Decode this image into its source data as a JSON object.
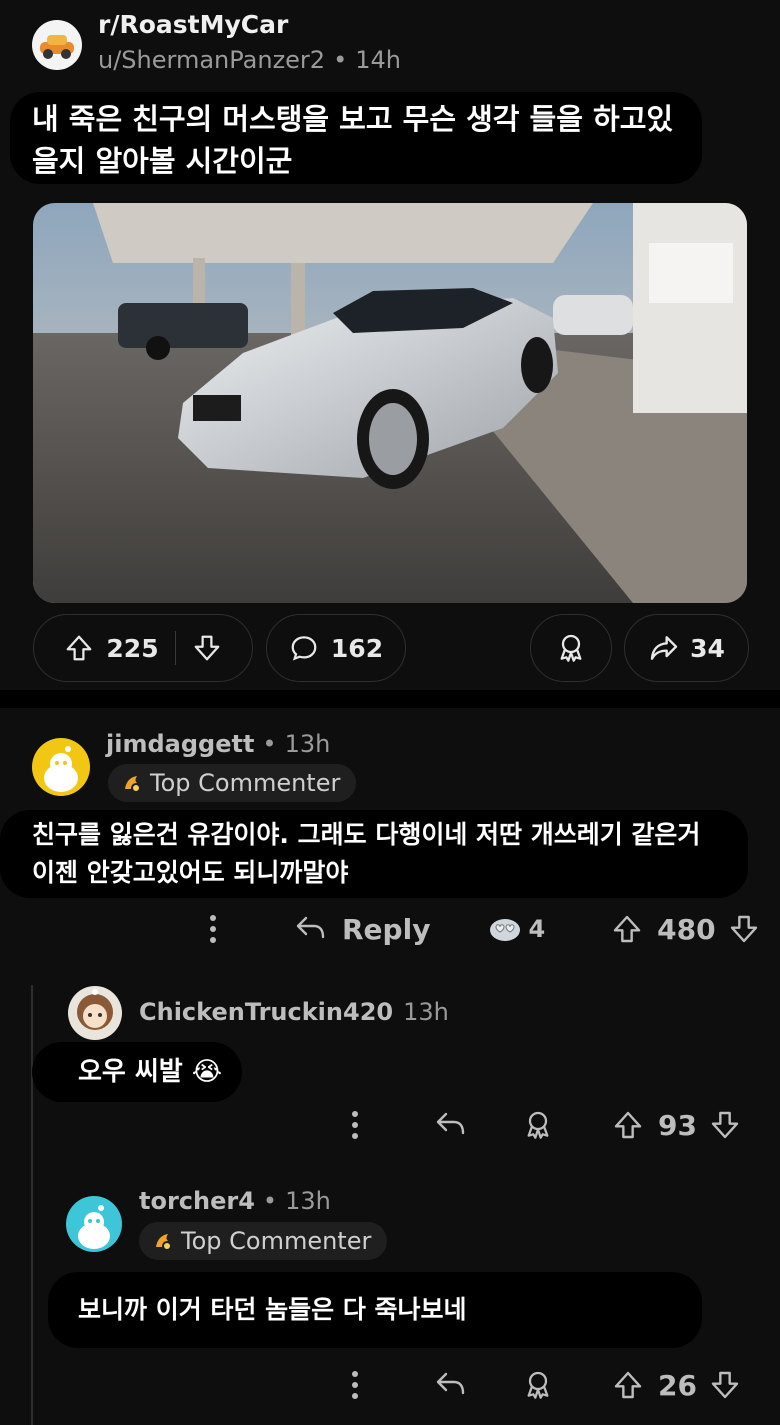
{
  "post": {
    "subreddit": "r/RoastMyCar",
    "author": "u/ShermanPanzer2",
    "time": "14h",
    "title": "내 죽은 친구의 머스탱을 보고 무슨 생각 들을 하고있을지 알아볼 시간이군",
    "upvotes": "225",
    "comments": "162",
    "shares": "34"
  },
  "comments": [
    {
      "author": "jimdaggett",
      "time": "13h",
      "badge": "Top Commenter",
      "text": "친구를 잃은건 유감이야. 그래도 다행이네 저딴 개쓰레기 같은거 이젠 안갖고있어도 되니까말야",
      "reply_label": "Reply",
      "awards": "4",
      "score": "480"
    },
    {
      "author": "ChickenTruckin420",
      "time": "13h",
      "text": "오우 씨발 😭",
      "score": "93"
    },
    {
      "author": "torcher4",
      "time": "13h",
      "badge": "Top Commenter",
      "text": "보니까 이거 타던 놈들은 다 죽나보네",
      "score": "26"
    }
  ],
  "colors": {
    "background": "#0e0e0e",
    "bubble": "#000000",
    "muted": "#9a9a9a",
    "avatar_yellow": "#f2c713",
    "avatar_teal": "#3cc6d8"
  },
  "icons": [
    "upvote-icon",
    "downvote-icon",
    "comment-icon",
    "award-icon",
    "share-icon",
    "more-icon",
    "reply-icon",
    "top-commenter-icon"
  ]
}
